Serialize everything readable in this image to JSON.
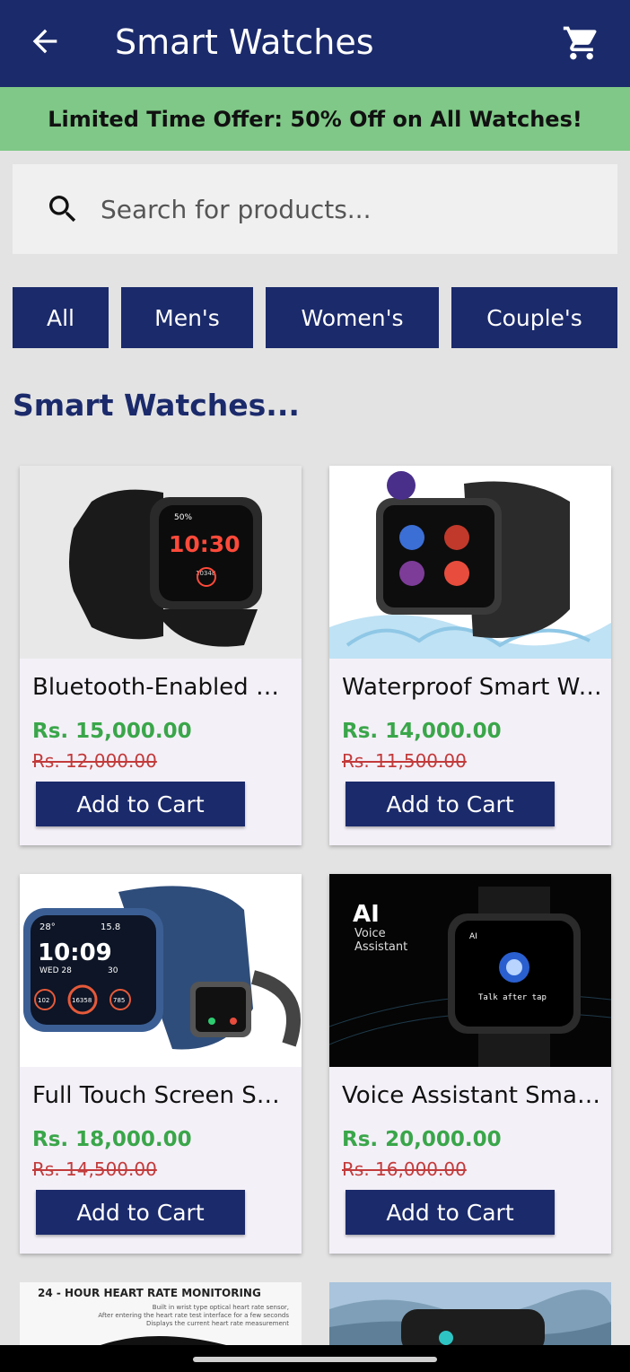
{
  "header": {
    "title": "Smart Watches",
    "back_icon": "arrow-back-icon",
    "cart_icon": "shopping-cart-icon"
  },
  "offer": {
    "text": "Limited Time Offer: 50% Off on All Watches!"
  },
  "search": {
    "placeholder": "Search for products...",
    "icon": "search-icon"
  },
  "categories": [
    "All",
    "Men's",
    "Women's",
    "Couple's"
  ],
  "section_title": "Smart Watches...",
  "products": [
    {
      "name": "Bluetooth-Enabled Smart Watch",
      "price": "Rs. 15,000.00",
      "old_price": "Rs. 12,000.00",
      "button": "Add to Cart",
      "image_text": {
        "battery": "50%",
        "time": "10:30",
        "steps": "10348"
      }
    },
    {
      "name": "Waterproof Smart Watch",
      "price": "Rs. 14,000.00",
      "old_price": "Rs. 11,500.00",
      "button": "Add to Cart"
    },
    {
      "name": "Full Touch Screen Smart Watch",
      "price": "Rs. 18,000.00",
      "old_price": "Rs. 14,500.00",
      "button": "Add to Cart",
      "image_text": {
        "temp": "28°",
        "aqi": "15.8",
        "time": "10:09",
        "day": "WED 28",
        "date": "30",
        "left": "102",
        "steps": "16358",
        "right": "785"
      }
    },
    {
      "name": "Voice Assistant Smart Watch",
      "price": "Rs. 20,000.00",
      "old_price": "Rs. 16,000.00",
      "button": "Add to Cart",
      "image_text": {
        "ai": "AI",
        "voice": "Voice",
        "assistant": "Assistant",
        "screen_ai": "AI",
        "tap": "Talk after tap"
      }
    }
  ],
  "partial_products": [
    {
      "heading": "24 - HOUR HEART RATE MONITORING",
      "lines": [
        "Built in wrist type optical heart rate sensor,",
        "After entering the heart rate test interface for a few seconds",
        "Displays the current heart rate measurement"
      ]
    },
    {
      "image": "watch-landscape-photo"
    }
  ],
  "colors": {
    "primary": "#1b2a6b",
    "offer_bg": "#7fc887",
    "price": "#3aa64a",
    "old_price": "#c23b3b",
    "card_bg": "#f4f0f8"
  }
}
